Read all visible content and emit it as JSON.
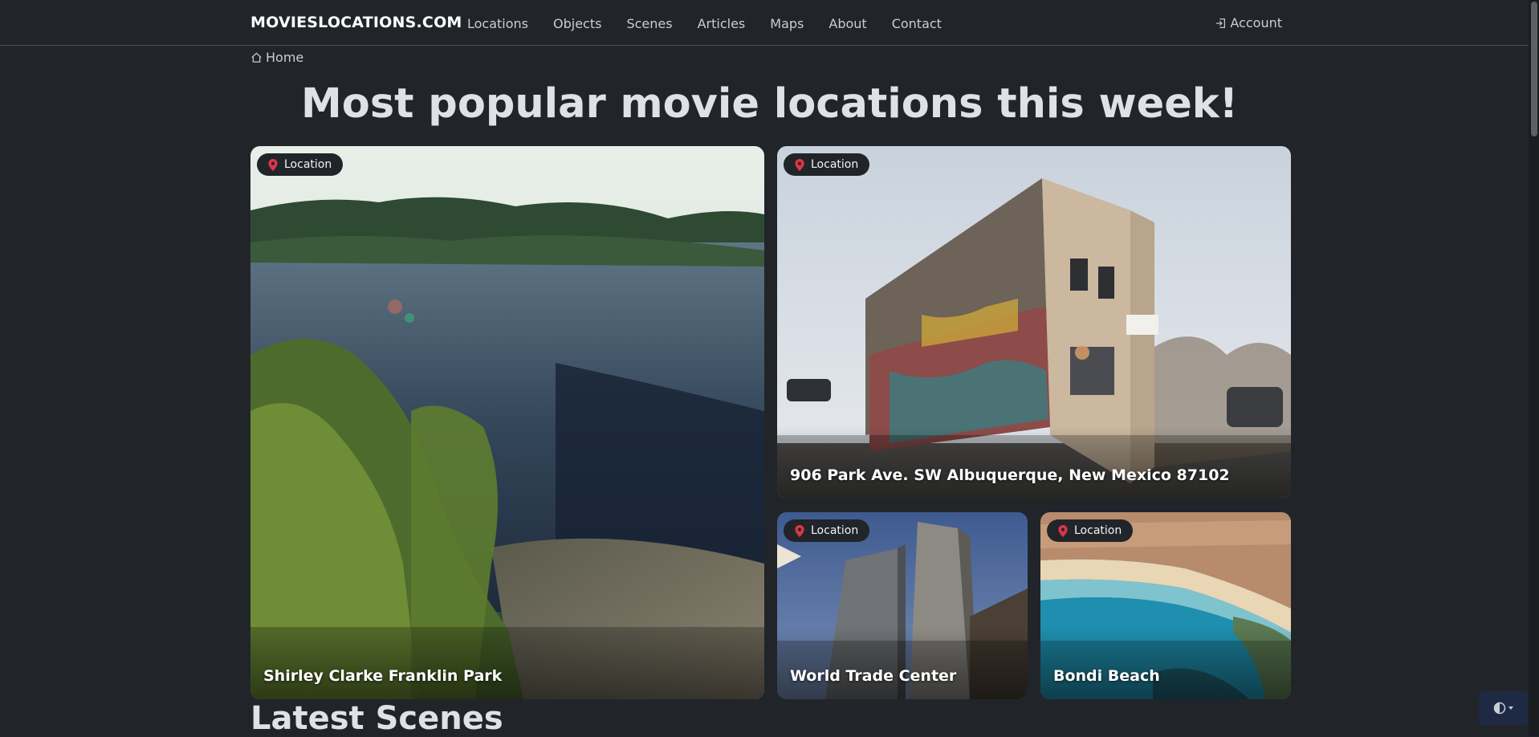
{
  "site": {
    "brand": "MOVIESLOCATIONS.COM"
  },
  "nav": {
    "items": [
      "Locations",
      "Objects",
      "Scenes",
      "Articles",
      "Maps",
      "About",
      "Contact"
    ],
    "account_label": "Account"
  },
  "breadcrumb": {
    "home_label": "Home"
  },
  "page": {
    "title": "Most popular movie locations this week!",
    "latest_title": "Latest Scenes"
  },
  "cards": [
    {
      "badge": "Location",
      "title": "Shirley Clarke Franklin Park"
    },
    {
      "badge": "Location",
      "title": "906 Park Ave. SW Albuquerque, New Mexico 87102"
    },
    {
      "badge": "Location",
      "title": "World Trade Center"
    },
    {
      "badge": "Location",
      "title": "Bondi Beach"
    }
  ],
  "colors": {
    "background": "#212529",
    "pin": "#dc3545",
    "text": "#dee2e6"
  },
  "icons": {
    "breadcrumb": "home-icon",
    "account": "login-icon",
    "badge": "map-pin-icon",
    "theme": "contrast-icon"
  }
}
